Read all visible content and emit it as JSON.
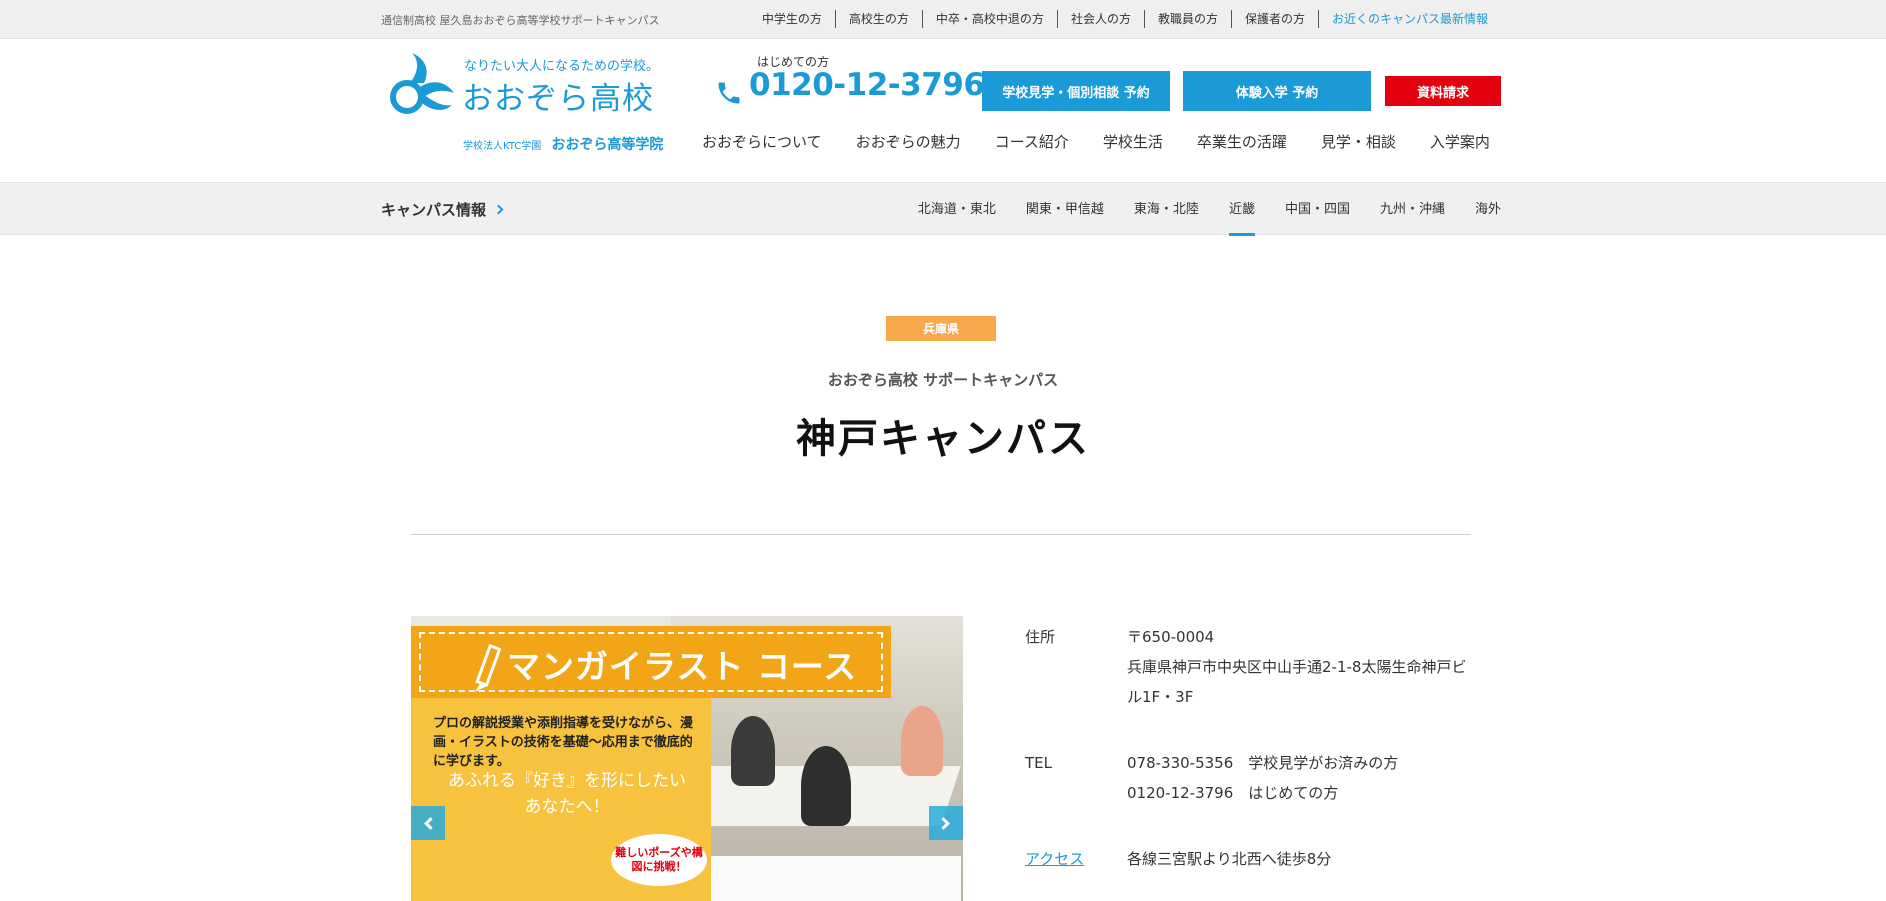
{
  "topbar": {
    "site_desc": "通信制高校 屋久島おおぞら高等学校サポートキャンパス",
    "nav": [
      {
        "label": "中学生の方"
      },
      {
        "label": "高校生の方"
      },
      {
        "label": "中卒・高校中退の方"
      },
      {
        "label": "社会人の方"
      },
      {
        "label": "教職員の方"
      },
      {
        "label": "保護者の方"
      },
      {
        "label": "お近くのキャンパス最新情報"
      }
    ]
  },
  "header": {
    "logo": {
      "tagline": "なりたい大人になるための学校。",
      "name": "おおぞら高校",
      "sub_small": "学校法人KTC学園",
      "sub_big": "おおぞら高等学院",
      "icon": "ozora-bird-logo"
    },
    "tel": {
      "label": "はじめての方",
      "number": "0120-12-3796",
      "icon": "phone-icon"
    },
    "buttons": {
      "visit": "学校見学・個別相談 予約",
      "trial": "体験入学 予約",
      "doc": "資料請求"
    },
    "nav": [
      {
        "label": "おおぞらについて"
      },
      {
        "label": "おおぞらの魅力"
      },
      {
        "label": "コース紹介"
      },
      {
        "label": "学校生活"
      },
      {
        "label": "卒業生の活躍"
      },
      {
        "label": "見学・相談"
      },
      {
        "label": "入学案内"
      }
    ]
  },
  "campusbar": {
    "title": "キャンパス情報",
    "regions": [
      {
        "label": "北海道・東北"
      },
      {
        "label": "関東・甲信越"
      },
      {
        "label": "東海・北陸"
      },
      {
        "label": "近畿"
      },
      {
        "label": "中国・四国"
      },
      {
        "label": "九州・沖縄"
      },
      {
        "label": "海外"
      }
    ],
    "active_region": "近畿"
  },
  "campus": {
    "prefecture": "兵庫県",
    "subtitle": "おおぞら高校 サポートキャンパス",
    "name": "神戸キャンパス"
  },
  "slider": {
    "title": "マンガイラスト コース",
    "text": "プロの解説授業や添削指導を受けながら、漫画・イラストの技術を基礎〜応用まで徹底的に学びます。",
    "catch": "あふれる『好き』を形にしたいあなたへ！",
    "bubble": "難しいポーズや構図に挑戦！"
  },
  "info": {
    "address_label": "住所",
    "postal": "〒650-0004",
    "address": "兵庫県神戸市中央区中山手通2-1-8太陽生命神戸ビル1F・3F",
    "tel_label": "TEL",
    "tel1": "078-330-5356　学校見学がお済みの方",
    "tel2": "0120-12-3796　はじめての方",
    "access_label": "アクセス",
    "access": "各線三宮駅より北西へ徒歩8分"
  },
  "colors": {
    "brand_blue": "#1b9ad6",
    "doc_red": "#e3000f",
    "badge_orange": "#f7a94c"
  }
}
